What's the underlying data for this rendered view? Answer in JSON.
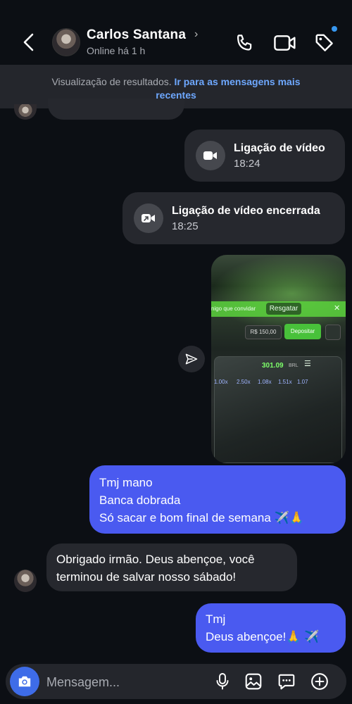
{
  "header": {
    "name": "Carlos Santana",
    "status": "Online há 1 h"
  },
  "banner": {
    "text": "Visualização de resultados.",
    "link_line1": "Ir para as mensagens mais",
    "link_line2": "recentes"
  },
  "messages": {
    "call1": {
      "title": "Ligação de vídeo",
      "time": "18:24"
    },
    "call2": {
      "title": "Ligação de vídeo encerrada",
      "time": "18:25"
    },
    "photo": {
      "invite": "nigo que convidar",
      "redeem": "Resgatar",
      "balance": "R$ 150,00",
      "deposit": "Depositar",
      "amount": "301.09",
      "currency": "BRL",
      "odds": [
        "1.00x",
        "2.50x",
        "1.08x",
        "1.51x",
        "1.07"
      ]
    },
    "out1": {
      "line1": "Tmj mano",
      "line2": "Banca dobrada",
      "line3": "Só sacar e bom final de semana ✈️🙏"
    },
    "in1": {
      "line1": "Obrigado irmão. Deus abençoe, você",
      "line2": "terminou de salvar nosso sábado!"
    },
    "out2": {
      "line1": "Tmj",
      "line2": "Deus abençoe!🙏 ✈️"
    }
  },
  "composer": {
    "placeholder": "Mensagem..."
  },
  "colors": {
    "background": "#0c0f14",
    "outgoing_bubble": "#4a5af0",
    "incoming_bubble": "#26282e",
    "link": "#6ea8ff",
    "camera_button": "#3e6ce8"
  }
}
